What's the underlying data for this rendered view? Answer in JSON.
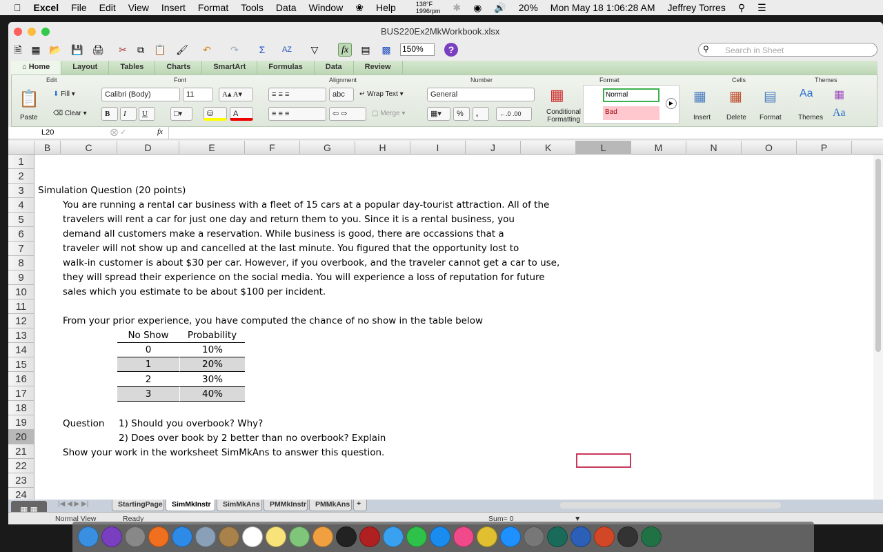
{
  "menubar": {
    "app": "Excel",
    "items": [
      "File",
      "Edit",
      "View",
      "Insert",
      "Format",
      "Tools",
      "Data",
      "Window",
      "Help"
    ],
    "temp": "138°F",
    "rpm": "1996rpm",
    "battery": "20%",
    "datetime": "Mon May 18  1:06:28 AM",
    "user": "Jeffrey Torres"
  },
  "window": {
    "title": "BUS220Ex2MkWorkbook.xlsx",
    "zoom": "150%",
    "search_placeholder": "Search in Sheet"
  },
  "ribbon": {
    "tabs": [
      "Home",
      "Layout",
      "Tables",
      "Charts",
      "SmartArt",
      "Formulas",
      "Data",
      "Review"
    ],
    "groups": {
      "edit": "Edit",
      "font": "Font",
      "alignment": "Alignment",
      "number": "Number",
      "format": "Format",
      "cells": "Cells",
      "themes": "Themes"
    },
    "paste": "Paste",
    "fill": "Fill",
    "clear": "Clear",
    "font_name": "Calibri (Body)",
    "font_size": "11",
    "bold": "B",
    "italic": "I",
    "underline": "U",
    "wrap_text": "Wrap Text",
    "merge": "Merge",
    "abc": "abc",
    "number_format": "General",
    "percent": "%",
    "comma": ",",
    "conditional_formatting": "Conditional Formatting",
    "style_normal": "Normal",
    "style_bad": "Bad",
    "insert": "Insert",
    "delete": "Delete",
    "format": "Format",
    "themes": "Themes"
  },
  "formula_bar": {
    "name_box": "L20",
    "fx": "fx",
    "value": ""
  },
  "columns": [
    "B",
    "C",
    "D",
    "E",
    "F",
    "G",
    "H",
    "I",
    "J",
    "K",
    "L",
    "M",
    "N",
    "O",
    "P"
  ],
  "rows": [
    "1",
    "2",
    "3",
    "4",
    "5",
    "6",
    "7",
    "8",
    "9",
    "10",
    "11",
    "12",
    "13",
    "14",
    "15",
    "16",
    "17",
    "18",
    "19",
    "20",
    "21",
    "22",
    "23",
    "24"
  ],
  "sheet": {
    "title": "Simulation Question (20 points)",
    "paragraph": [
      "You are running a rental car business with a fleet of 15 cars at a popular day-tourist attraction.  All of the",
      "travelers will rent a car for just one day and return them to you.  Since it is a rental business, you",
      "demand all customers make a reservation.  While business is good, there are occassions that a",
      "traveler will not show up and cancelled at the last minute.  You figured that the opportunity lost to",
      "walk-in customer is about $30 per car.  However, if you overbook, and the traveler cannot get a car to use,",
      "they will spread their experience on the social media.  You will experience a loss of reputation for future",
      "sales which you estimate to be about $100 per incident."
    ],
    "intro": "From your prior experience, you have computed the chance of no show in the table below",
    "table": {
      "headers": [
        "No Show",
        "Probability"
      ],
      "rows": [
        [
          "0",
          "10%"
        ],
        [
          "1",
          "20%"
        ],
        [
          "2",
          "30%"
        ],
        [
          "3",
          "40%"
        ]
      ]
    },
    "question_label": "Question",
    "q1": "1) Should you overbook? Why?",
    "q2": "2) Does over book by 2 better than no overbook? Explain",
    "instruction": "Show your work in the worksheet SimMkAns to answer this question."
  },
  "sheet_tabs": [
    "StartingPage",
    "SimMkInstr",
    "SimMkAns",
    "PMMkInstr",
    "PMMkAns"
  ],
  "active_tab": "SimMkInstr",
  "status": {
    "view": "Normal View",
    "state": "Ready",
    "sum": "Sum= 0"
  },
  "dock": [
    {
      "name": "finder",
      "color": "#3b8fe0"
    },
    {
      "name": "siri",
      "color": "#7a3fc0"
    },
    {
      "name": "launchpad",
      "color": "#888"
    },
    {
      "name": "firefox",
      "color": "#f07020"
    },
    {
      "name": "safari",
      "color": "#2d8ae6"
    },
    {
      "name": "preview",
      "color": "#8aa0b8"
    },
    {
      "name": "contacts",
      "color": "#a8824a"
    },
    {
      "name": "calendar",
      "color": "#fff"
    },
    {
      "name": "notes",
      "color": "#f8e27a"
    },
    {
      "name": "maps",
      "color": "#7fc57a"
    },
    {
      "name": "photos",
      "color": "#f0a040"
    },
    {
      "name": "activity-monitor",
      "color": "#222"
    },
    {
      "name": "photo-booth",
      "color": "#b02020"
    },
    {
      "name": "messages",
      "color": "#3aa0f0"
    },
    {
      "name": "facetime",
      "color": "#2ec24a"
    },
    {
      "name": "shazam",
      "color": "#1a8cf0"
    },
    {
      "name": "itunes",
      "color": "#f04a8a"
    },
    {
      "name": "nuclear",
      "color": "#e0c030"
    },
    {
      "name": "app-store",
      "color": "#1e90ff"
    },
    {
      "name": "system-preferences",
      "color": "#777"
    },
    {
      "name": "time-machine",
      "color": "#1a6a5a"
    },
    {
      "name": "word",
      "color": "#2b5fb8"
    },
    {
      "name": "powerpoint",
      "color": "#d24726"
    },
    {
      "name": "piano",
      "color": "#333"
    },
    {
      "name": "excel",
      "color": "#207245"
    }
  ]
}
